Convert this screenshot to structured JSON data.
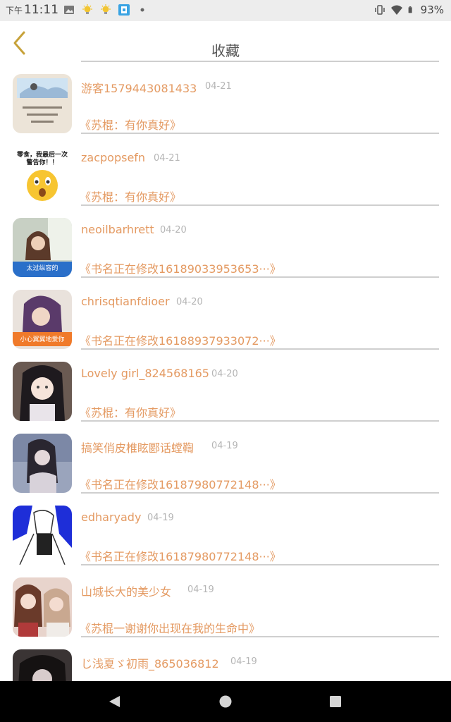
{
  "status_bar": {
    "time_prefix": "下午",
    "time": "11:11",
    "battery": "93%",
    "icons": [
      "image-icon",
      "lightbulb-icon",
      "lightbulb-icon",
      "app-icon",
      "dot-icon",
      "vibrate-icon",
      "wifi-icon",
      "battery-icon"
    ]
  },
  "header": {
    "title": "收藏",
    "back_icon": "chevron-left-icon"
  },
  "colors": {
    "accent": "#e49a62",
    "date": "#b5b5b5",
    "back_icon": "#c7a23a",
    "divider": "#cfcfcf"
  },
  "favorites": [
    {
      "user": "游客1579443081433",
      "date": "04-21",
      "book": "《苏棍：有你真好》",
      "avatar_label": ""
    },
    {
      "user": "zacpopsefn",
      "date": "04-21",
      "book": "《苏棍：有你真好》",
      "avatar_label": "零食，我最后一次警告你！！"
    },
    {
      "user": "neoilbarhrett",
      "date": "04-20",
      "book": "《书名正在修改16189033953653···》",
      "avatar_label": "太过纵容的"
    },
    {
      "user": "chrisqtianfdioer",
      "date": "04-20",
      "book": "《书名正在修改16188937933072···》",
      "avatar_label": "小心翼翼地爱你"
    },
    {
      "user": "Lovely girl_824568165",
      "date": "04-20",
      "book": "《苏棍：有你真好》",
      "avatar_label": ""
    },
    {
      "user": "搞笑俏皮椎眩郾话螳鞫",
      "date": "04-19",
      "book": "《书名正在修改16187980772148···》",
      "avatar_label": ""
    },
    {
      "user": "edharyady",
      "date": "04-19",
      "book": "《书名正在修改16187980772148···》",
      "avatar_label": ""
    },
    {
      "user": "山城长大的美少女",
      "date": "04-19",
      "book": "《苏棍一谢谢你出现在我的生命中》",
      "avatar_label": ""
    },
    {
      "user": "じ浅夏ゞ初雨_865036812",
      "date": "04-19",
      "book": "",
      "avatar_label": ""
    }
  ],
  "nav": {
    "icons": [
      "back-triangle-icon",
      "home-circle-icon",
      "recents-square-icon"
    ]
  }
}
